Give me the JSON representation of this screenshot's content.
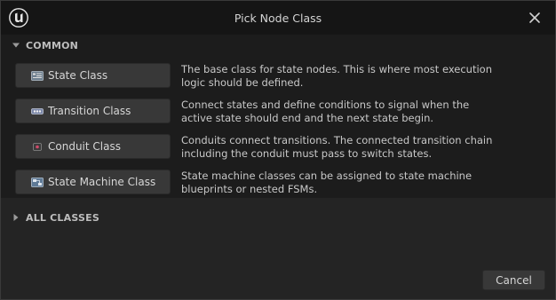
{
  "window": {
    "title": "Pick Node Class",
    "logo_icon": "unreal-engine-logo-icon",
    "close_icon": "close-icon"
  },
  "sections": {
    "common": {
      "label": "COMMON",
      "expanded": true,
      "items": [
        {
          "label": "State Class",
          "icon": "state-node-icon",
          "description_line1": "The base class for state nodes. This is where most execution",
          "description_line2": "logic should be defined."
        },
        {
          "label": "Transition Class",
          "icon": "transition-node-icon",
          "description_line1": "Connect states and define conditions to signal when the",
          "description_line2": "active state should end and the next state begin."
        },
        {
          "label": "Conduit Class",
          "icon": "conduit-node-icon",
          "description_line1": "Conduits connect transitions. The connected transition chain",
          "description_line2": "including the conduit must pass to switch states."
        },
        {
          "label": "State Machine Class",
          "icon": "state-machine-icon",
          "description_line1": "State machine classes can be assigned to state machine",
          "description_line2": "blueprints or nested FSMs."
        }
      ]
    },
    "all_classes": {
      "label": "ALL CLASSES",
      "expanded": false
    }
  },
  "footer": {
    "cancel_label": "Cancel"
  },
  "colors": {
    "window_bg": "#242424",
    "titlebar_bg": "#151515",
    "section_bg": "#1c1c1c",
    "button_bg": "#383838",
    "text": "#c8c8c8"
  }
}
